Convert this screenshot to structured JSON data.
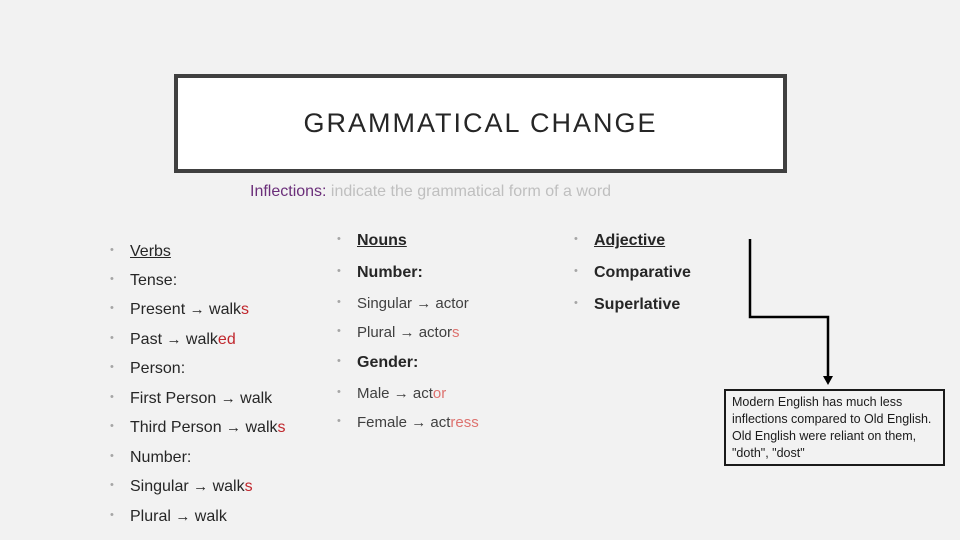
{
  "slide": {
    "title": "GRAMMATICAL CHANGE",
    "subtitle": {
      "term": "Inflections:",
      "definition": " indicate the grammatical form of a word"
    }
  },
  "columns": {
    "verbs": [
      {
        "text": "Verbs",
        "style": "heading"
      },
      {
        "text": "Tense:"
      },
      {
        "base": "Present ",
        "arrow": "→",
        "word": " walk",
        "suffix": "s"
      },
      {
        "base": "Past ",
        "arrow": "→",
        "word": " walk",
        "suffix": "ed"
      },
      {
        "text": "Person:"
      },
      {
        "base": "First Person ",
        "arrow": "→",
        "word": " walk",
        "suffix": ""
      },
      {
        "base": "Third Person ",
        "arrow": "→",
        "word": " walk",
        "suffix": "s"
      },
      {
        "text": "Number:"
      },
      {
        "base": "Singular ",
        "arrow": "→",
        "word": " walk",
        "suffix": "s"
      },
      {
        "base": "Plural ",
        "arrow": "→",
        "word": " walk",
        "suffix": ""
      }
    ],
    "nouns": [
      {
        "text": "Nouns",
        "style": "heading"
      },
      {
        "text": "Number:"
      },
      {
        "base": "Singular ",
        "arrow": "→",
        "word": " actor",
        "suffix": ""
      },
      {
        "base": "Plural ",
        "arrow": "→",
        "word": " actor",
        "suffix": "s"
      },
      {
        "text": "Gender:"
      },
      {
        "base": "Male ",
        "arrow": "→",
        "word": " act",
        "suffix": "or"
      },
      {
        "base": "Female ",
        "arrow": "→",
        "word": " act",
        "suffix": "ress"
      }
    ],
    "adjectives": [
      {
        "text": "Adjective",
        "style": "heading"
      },
      {
        "text": "Comparative"
      },
      {
        "text": "Superlative"
      }
    ]
  },
  "note": {
    "text": "Modern English has much less inflections compared to Old English. Old English were reliant on them, \"doth\", \"dost\""
  },
  "colors": {
    "term": "#6b2f7a",
    "definition": "#bfbfbf",
    "suffix_highlight": "#c0272d",
    "title_border": "#404040",
    "background": "#f2f2f2"
  },
  "bullet": "•"
}
